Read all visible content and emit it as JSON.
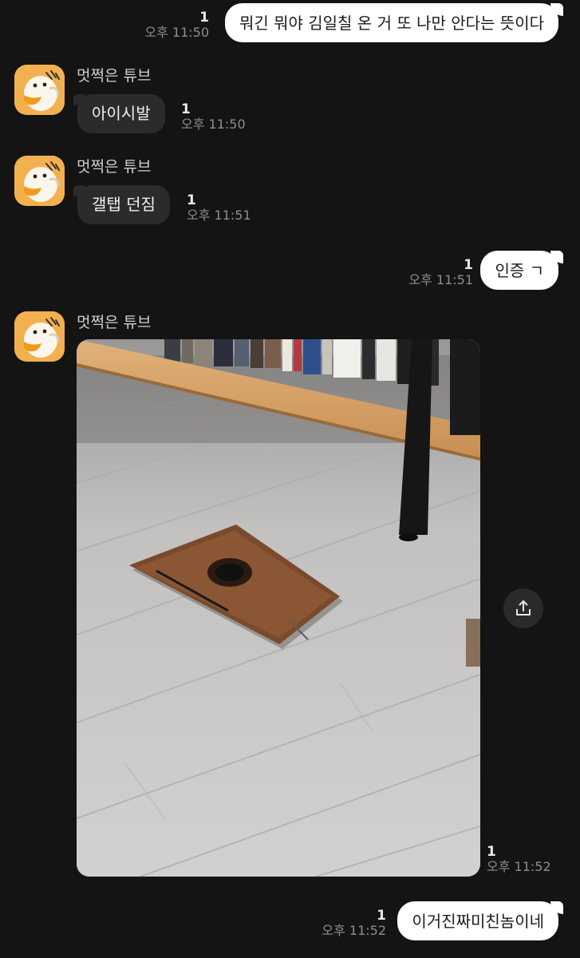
{
  "chat": {
    "sender_name": "멋쩍은 튜브",
    "messages": [
      {
        "direction": "out",
        "text": "뭐긴 뭐야 김일칠 온 거 또 나만 안다는 뜻이다",
        "unread": "1",
        "time": "오후 11:50"
      },
      {
        "direction": "in",
        "text": "아이시발",
        "unread": "1",
        "time": "오후 11:50"
      },
      {
        "direction": "in",
        "text": "갤탭 던짐",
        "unread": "1",
        "time": "오후 11:51"
      },
      {
        "direction": "out",
        "text": "인증 ㄱ",
        "unread": "1",
        "time": "오후 11:51"
      },
      {
        "direction": "in",
        "type": "photo",
        "unread": "1",
        "time": "오후 11:52"
      },
      {
        "direction": "out",
        "text": "이거진짜미친놈이네",
        "unread": "1",
        "time": "오후 11:52"
      }
    ]
  },
  "icons": {
    "avatar": "tube-duck-avatar-icon",
    "share": "share-upload-icon"
  },
  "colors": {
    "background": "#141414",
    "outgoing_bubble": "#ffffff",
    "incoming_bubble": "#2b2b2b",
    "avatar_bg": "#f3b04e"
  }
}
